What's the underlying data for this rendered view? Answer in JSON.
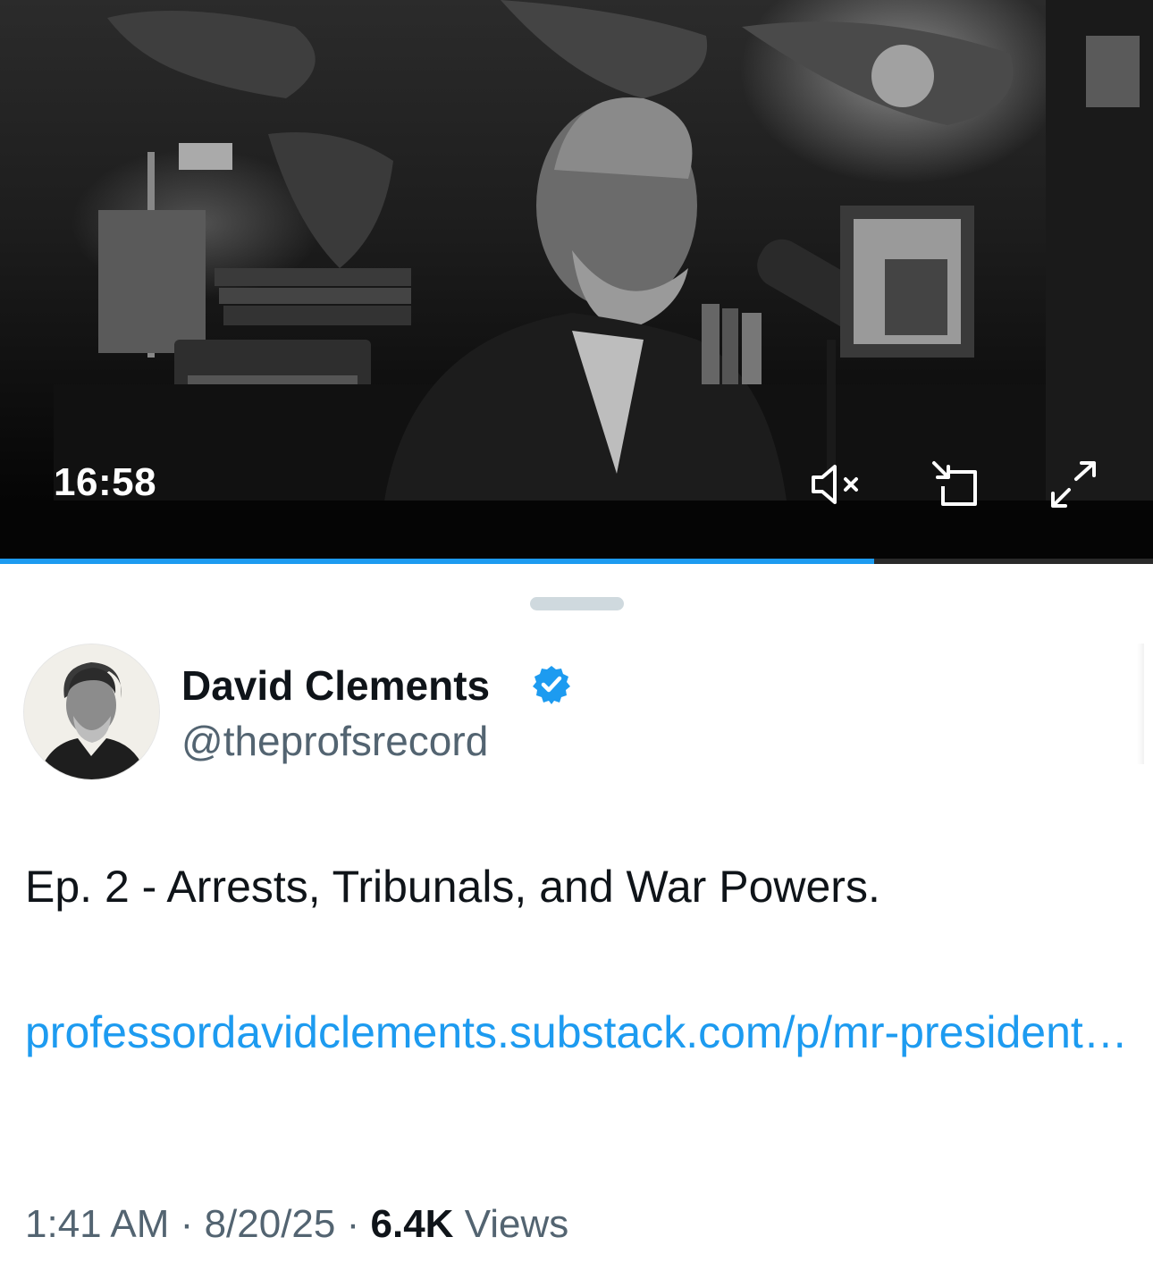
{
  "video": {
    "duration": "16:58",
    "progress": 0.758,
    "poster_description_icons": [
      "map-wall",
      "person-at-microphone"
    ],
    "controls": {
      "mute_icon": "muted-speaker-icon",
      "dock_icon": "picture-in-picture-icon",
      "fullscreen_icon": "expand-icon"
    },
    "accent_color": "#1d9bf0"
  },
  "author": {
    "name": "David Clements",
    "handle": "@theprofsrecord",
    "verified": true,
    "verified_color": "#1d9bf0"
  },
  "tweet": {
    "text": "Ep. 2 - Arrests, Tribunals, and War Powers.",
    "link": "professordavidclements.substack.com/p/mr-president…"
  },
  "meta": {
    "time": "1:41 AM",
    "separator": "·",
    "date": "8/20/25",
    "views_count": "6.4K",
    "views_label": "Views"
  }
}
